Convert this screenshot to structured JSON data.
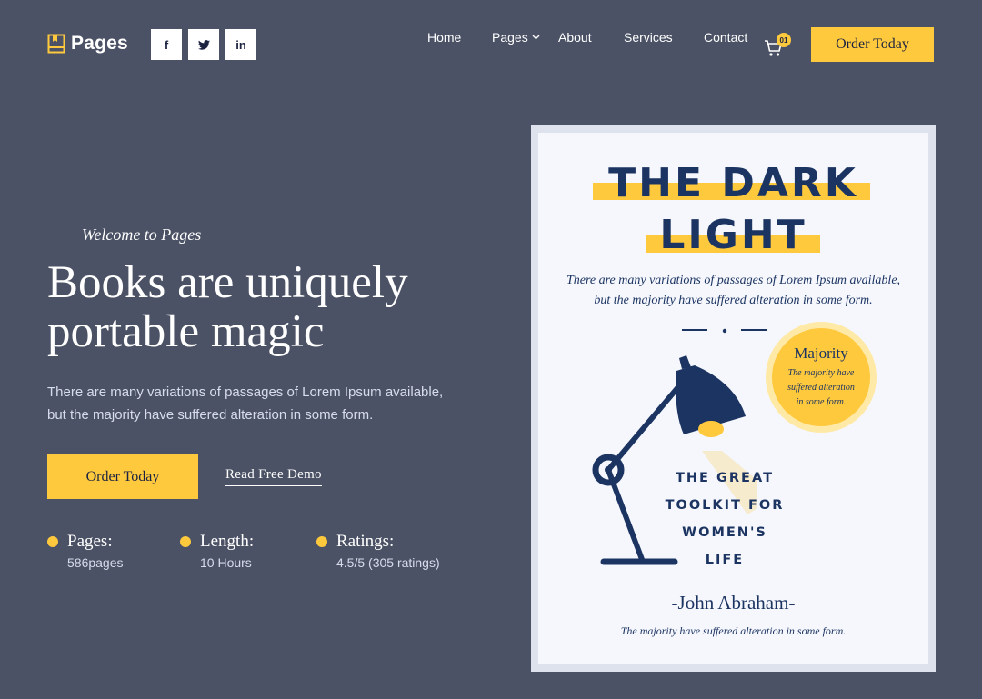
{
  "brand": {
    "name": "Pages"
  },
  "socials": [
    "f",
    "t",
    "in"
  ],
  "nav": {
    "items": [
      "Home",
      "Pages",
      "About",
      "Services",
      "Contact"
    ],
    "cart_count": "01",
    "order_label": "Order Today"
  },
  "hero": {
    "eyebrow": "Welcome to Pages",
    "title_line1": "Books are uniquely",
    "title_line2": "portable magic",
    "description": "There are many variations of passages of Lorem Ipsum available, but the majority have suffered alteration in some form.",
    "order_label": "Order Today",
    "demo_label": "Read Free Demo"
  },
  "stats": [
    {
      "label": "Pages:",
      "value": "586pages"
    },
    {
      "label": "Length:",
      "value": "10 Hours"
    },
    {
      "label": "Ratings:",
      "value": "4.5/5 (305 ratings)"
    }
  ],
  "book": {
    "title_line1": "THE DARK",
    "title_line2": "LIGHT",
    "subtitle": "There are many variations of passages of Lorem Ipsum available, but the majority have suffered alteration in some form.",
    "badge_title": "Majority",
    "badge_text": "The majority have suffered alteration in some form.",
    "headline_1": "THE GREAT",
    "headline_2": "TOOLKIT FOR",
    "headline_3": "WOMEN'S",
    "headline_4": "LIFE",
    "author": "-John Abraham-",
    "footer": "The majority have suffered alteration in some form."
  },
  "colors": {
    "background": "#4b5265",
    "accent": "#ffc93e",
    "navy": "#1c3461",
    "book_paper": "#f5f7fd"
  }
}
